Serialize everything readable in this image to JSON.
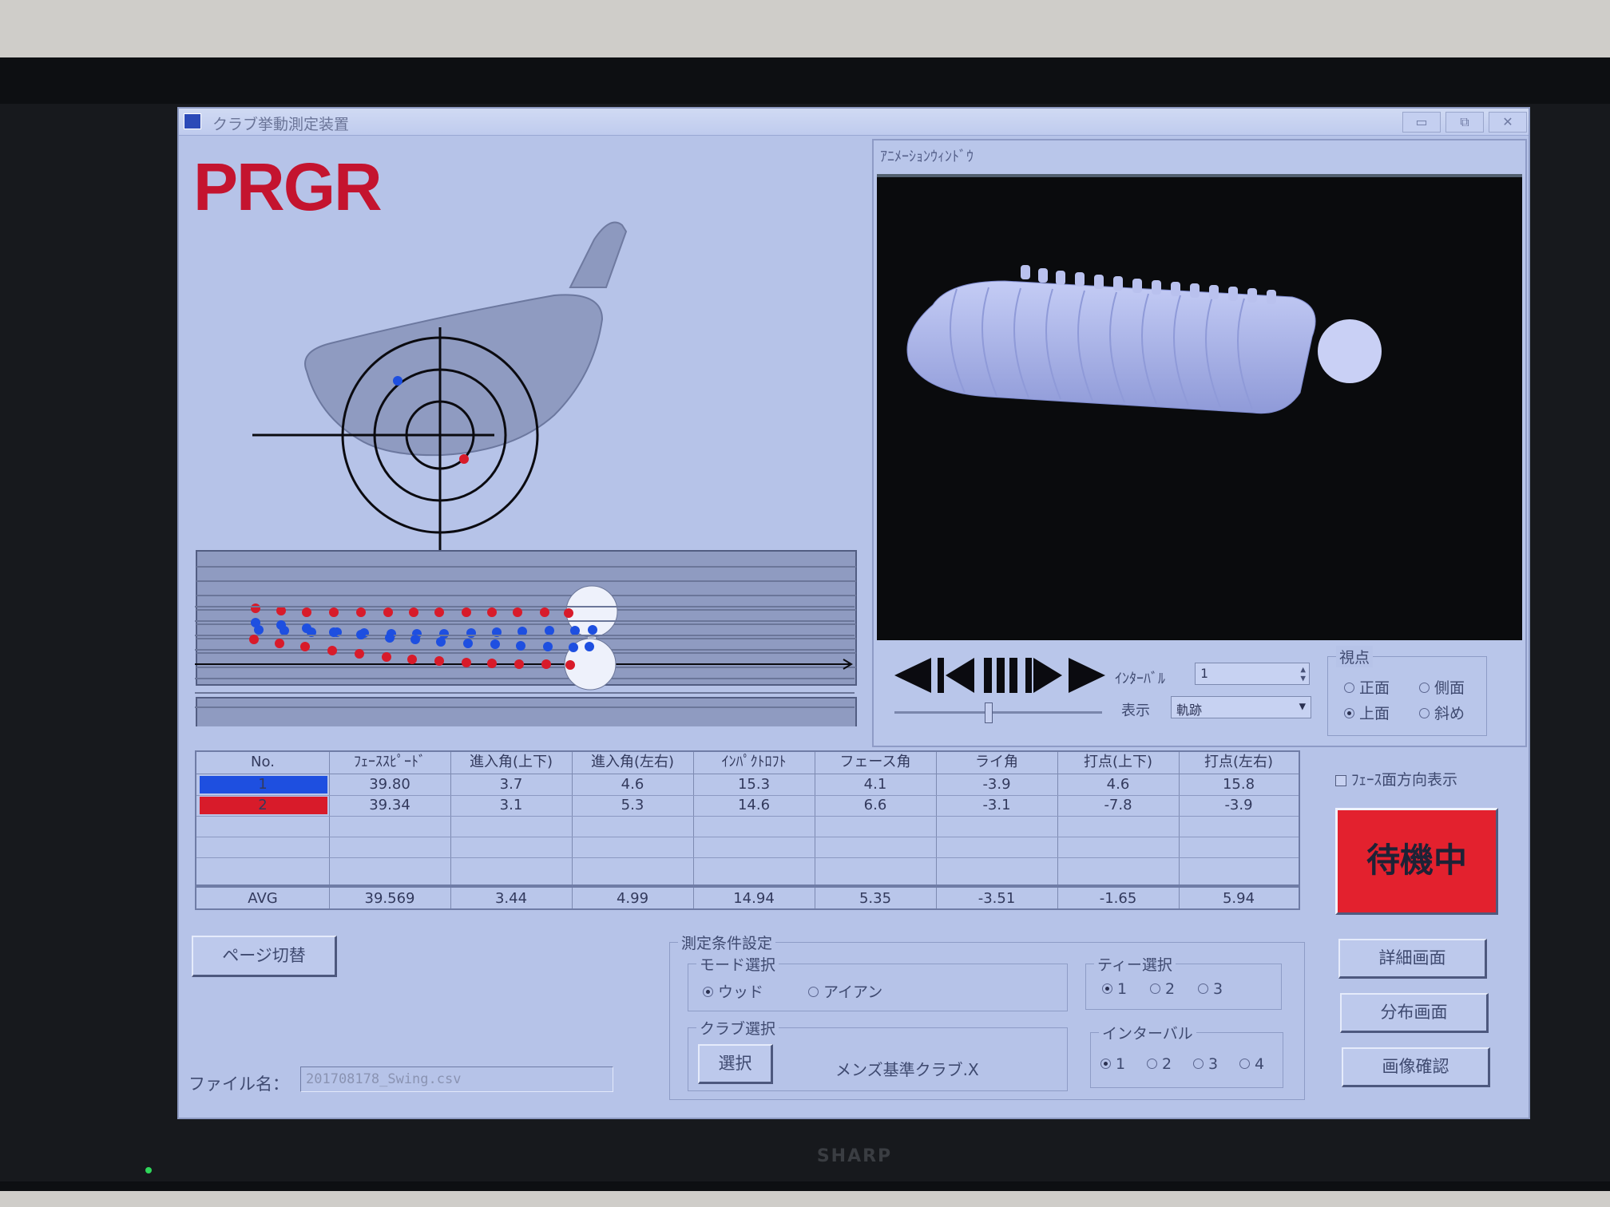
{
  "window": {
    "title": "クラブ挙動測定装置",
    "controls": [
      "▭",
      "⧉",
      "✕"
    ]
  },
  "logo": "PRGR",
  "monitor_brand": "SHARP",
  "animation": {
    "title": "ｱﾆﾒｰｼｮﾝｳｨﾝﾄﾞｳ",
    "interval_label": "ｲﾝﾀｰﾊﾞﾙ",
    "interval_value": "1",
    "display_label": "表示",
    "display_value": "軌跡",
    "slider_value": 0.45,
    "viewpoint": {
      "legend": "視点",
      "options": [
        {
          "label": "正面",
          "selected": false
        },
        {
          "label": "側面",
          "selected": false
        },
        {
          "label": "上面",
          "selected": true
        },
        {
          "label": "斜め",
          "selected": false
        }
      ]
    }
  },
  "table": {
    "headers": [
      "No.",
      "ﾌｪｰｽｽﾋﾟｰﾄﾞ",
      "進入角(上下)",
      "進入角(左右)",
      "ｲﾝﾊﾟｸﾄﾛﾌﾄ",
      "フェース角",
      "ライ角",
      "打点(上下)",
      "打点(左右)"
    ],
    "rows": [
      {
        "no": "1",
        "color": "#1e4fe0",
        "values": [
          "39.80",
          "3.7",
          "4.6",
          "15.3",
          "4.1",
          "-3.9",
          "4.6",
          "15.8"
        ]
      },
      {
        "no": "2",
        "color": "#d81b2a",
        "values": [
          "39.34",
          "3.1",
          "5.3",
          "14.6",
          "6.6",
          "-3.1",
          "-7.8",
          "-3.9"
        ]
      }
    ],
    "avg_label": "AVG",
    "avg_values": [
      "39.569",
      "3.44",
      "4.99",
      "14.94",
      "5.35",
      "-3.51",
      "-1.65",
      "5.94"
    ]
  },
  "face_direction_checkbox": {
    "label": "ﾌｪｰｽ面方向表示",
    "checked": false
  },
  "status_button": "待機中",
  "right_buttons": [
    "詳細画面",
    "分布画面",
    "画像確認"
  ],
  "page_switch_button": "ページ切替",
  "measure": {
    "legend": "測定条件設定",
    "mode": {
      "legend": "モード選択",
      "options": [
        {
          "label": "ウッド",
          "selected": true
        },
        {
          "label": "アイアン",
          "selected": false
        }
      ]
    },
    "tee": {
      "legend": "ティー選択",
      "options": [
        {
          "label": "1",
          "selected": true
        },
        {
          "label": "2",
          "selected": false
        },
        {
          "label": "3",
          "selected": false
        }
      ]
    },
    "club": {
      "legend": "クラブ選択",
      "select_button": "選択",
      "club_name": "メンズ基準クラブ.X"
    },
    "interval": {
      "legend": "インターバル",
      "options": [
        {
          "label": "1",
          "selected": true
        },
        {
          "label": "2",
          "selected": false
        },
        {
          "label": "3",
          "selected": false
        },
        {
          "label": "4",
          "selected": false
        }
      ]
    }
  },
  "file": {
    "label": "ファイル名：",
    "value": "201708178_Swing.csv"
  },
  "colors": {
    "blue": "#1e4fe0",
    "red": "#d81b2a",
    "window_bg": "#b6c3e8",
    "standby": "#e3212e"
  }
}
